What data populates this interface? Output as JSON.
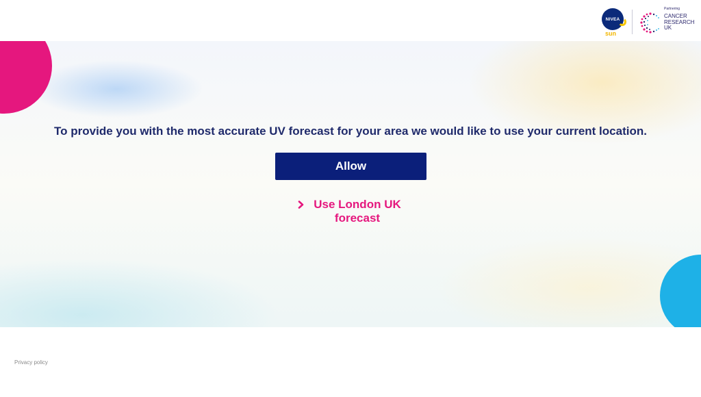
{
  "header": {
    "nivea_logo": {
      "wordmark": "NIVEA",
      "sub": "sun"
    },
    "partner_logo": {
      "tagline": "Partnering",
      "lines": [
        "CANCER",
        "RESEARCH",
        "UK"
      ]
    }
  },
  "main": {
    "message": "To provide you with the most accurate UV forecast for your area we would like to use your current location.",
    "allow_label": "Allow",
    "london_label": "Use London UK forecast"
  },
  "footer": {
    "privacy_label": "Privacy policy"
  },
  "colors": {
    "navy": "#0b1f7a",
    "pink": "#e5177e",
    "cyan": "#1eb1e7",
    "text": "#1f2a6b"
  }
}
